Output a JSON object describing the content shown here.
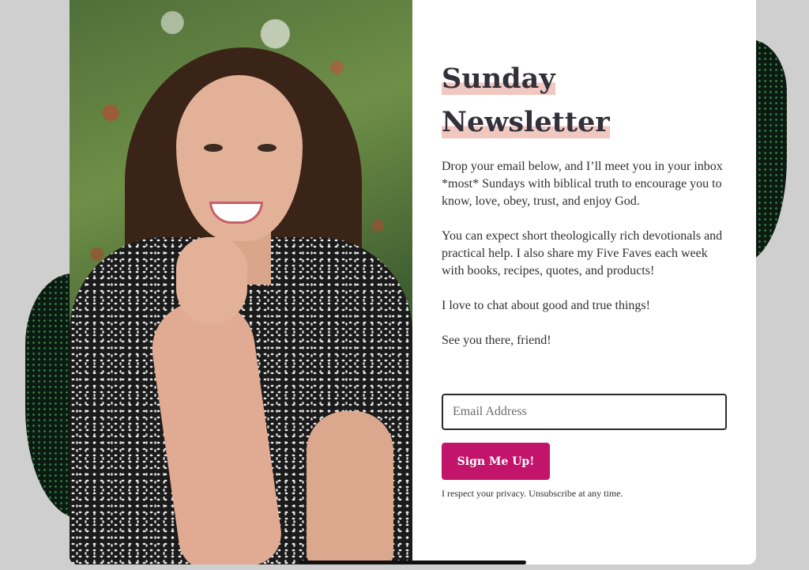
{
  "newsletter": {
    "title_line1": "Sunday",
    "title_line2": "Newsletter",
    "paragraphs": [
      "Drop your email below, and I’ll meet you in your inbox *most* Sundays with biblical truth to encourage you to know, love, obey, trust, and enjoy God.",
      "You can expect short theologically rich devotionals and practical help. I also share my Five Faves each week with books, recipes, quotes, and products!",
      "I love to chat about good and true things!",
      "See you there, friend!"
    ],
    "email_placeholder": "Email Address",
    "email_value": "",
    "button_label": "Sign Me Up!",
    "privacy_text": "I respect your privacy. Unsubscribe at any time."
  },
  "colors": {
    "accent_button": "#c2146b",
    "title_highlight": "#f0c8c0",
    "backdrop": "#cfcfcf",
    "blob_pattern": "#2f8a4a"
  },
  "icons": {
    "home_indicator": "home-indicator-bar"
  }
}
